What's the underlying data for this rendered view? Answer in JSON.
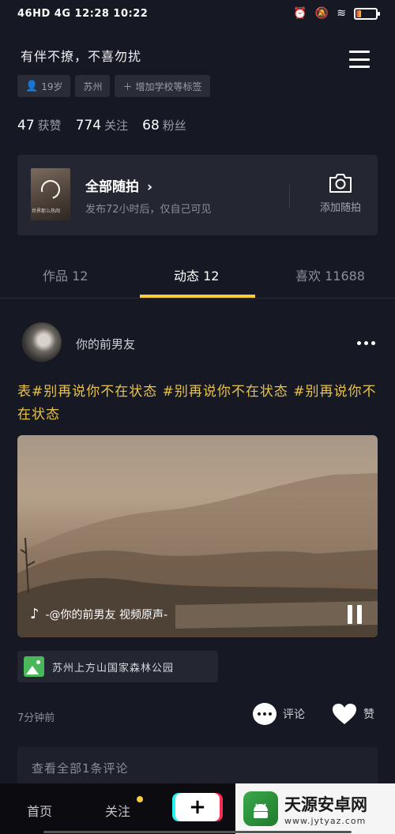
{
  "status_bar": {
    "left_text": "46HD 4G 12:28 10:22",
    "battery_level": 0.25
  },
  "profile": {
    "signature": "有伴不撩，不喜勿扰",
    "tags": {
      "age": "19岁",
      "city": "苏州",
      "add_school": "增加学校等标签"
    },
    "stats": {
      "likes_count": "47",
      "likes_label": "获赞",
      "following_count": "774",
      "following_label": "关注",
      "fans_count": "68",
      "fans_label": "粉丝"
    }
  },
  "moments": {
    "title": "全部随拍",
    "subtitle": "发布72小时后，仅自己可见",
    "thumb_caption": "世界那么热闹",
    "camera_label": "添加随拍"
  },
  "tabs": [
    {
      "label": "作品 12"
    },
    {
      "label": "动态 12"
    },
    {
      "label": "喜欢 11688"
    }
  ],
  "post": {
    "author": "你的前男友",
    "text": "表#别再说你不在状态 #别再说你不在状态 #别再说你不在状态",
    "video_caption": "-@你的前男友  视频原声-",
    "location": "苏州上方山国家森林公园",
    "time": "7分钟前",
    "comment_label": "评论",
    "like_label": "赞",
    "view_comments": "查看全部1条评论"
  },
  "bottom_nav": {
    "home": "首页",
    "follow": "关注",
    "plus": "+"
  },
  "watermark": {
    "title": "天源安卓网",
    "url": "www.jytyaz.com"
  },
  "colors": {
    "background": "#161823",
    "accent_yellow": "#facc3c",
    "hashtag": "#e8c34a"
  }
}
